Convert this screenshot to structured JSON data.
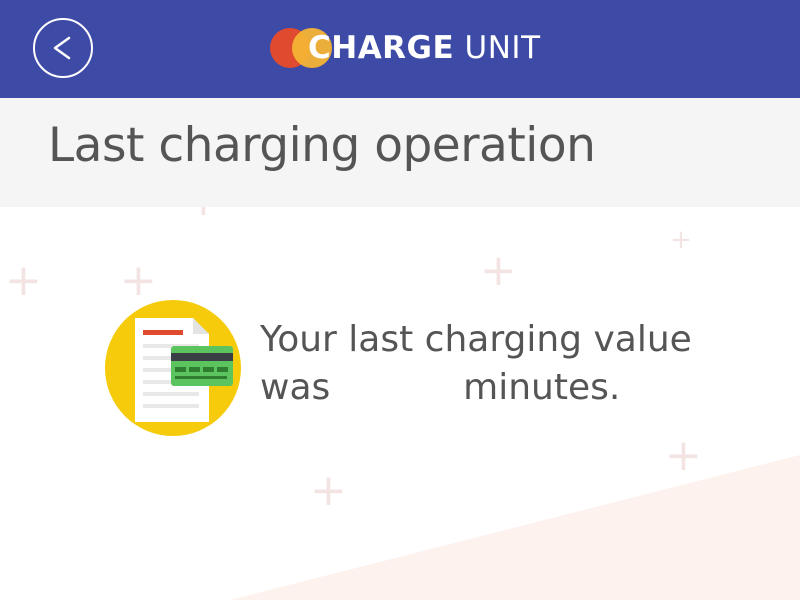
{
  "header": {
    "back_icon": "chevron-left-icon",
    "logo": {
      "brand_bold": "CHARGE",
      "brand_light": "UNIT",
      "brand_colors": [
        "#e04a2f",
        "#f5b335"
      ]
    },
    "background_color": "#3d4ba6"
  },
  "page": {
    "title": "Last charging operation"
  },
  "main": {
    "icon": "document-credit-card-icon",
    "message_prefix": "Your last charging value",
    "message_was": "was",
    "value": "",
    "message_suffix": "minutes.",
    "icon_color": "#f6cb0b"
  }
}
